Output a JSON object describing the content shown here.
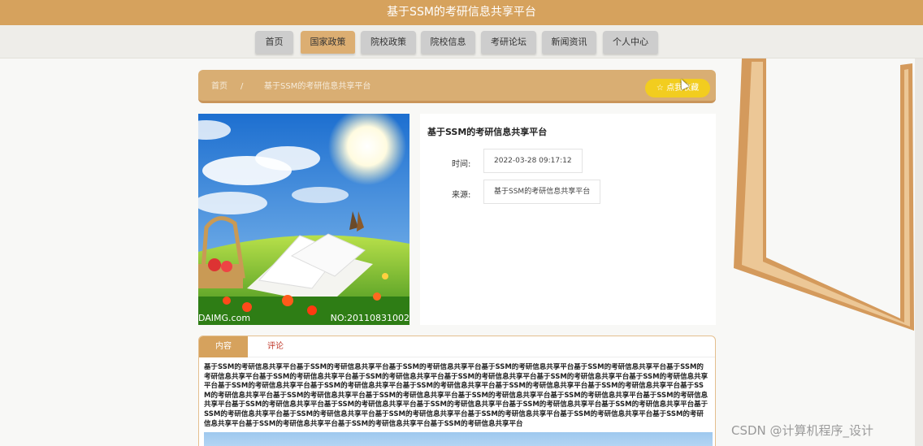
{
  "app": {
    "title": "基于SSM的考研信息共享平台"
  },
  "nav": {
    "items": [
      {
        "label": "首页",
        "active": false
      },
      {
        "label": "国家政策",
        "active": true
      },
      {
        "label": "院校政策",
        "active": false
      },
      {
        "label": "院校信息",
        "active": false
      },
      {
        "label": "考研论坛",
        "active": false
      },
      {
        "label": "新闻资讯",
        "active": false
      },
      {
        "label": "个人中心",
        "active": false
      }
    ]
  },
  "breadcrumb": {
    "home": "首页",
    "separator": "/",
    "current": "基于SSM的考研信息共享平台"
  },
  "favorite": {
    "label": "☆ 点我收藏"
  },
  "image": {
    "left_caption": "DAIMG.com",
    "right_caption": "NO:20110831002"
  },
  "detail": {
    "title": "基于SSM的考研信息共享平台",
    "time_label": "时间:",
    "time_value": "2022-03-28 09:17:12",
    "source_label": "来源:",
    "source_value": "基于SSM的考研信息共享平台"
  },
  "tabs": [
    {
      "label": "内容"
    },
    {
      "label": "评论"
    }
  ],
  "content": {
    "body": "基于SSM的考研信息共享平台基于SSM的考研信息共享平台基于SSM的考研信息共享平台基于SSM的考研信息共享平台基于SSM的考研信息共享平台基于SSM的考研信息共享平台基于SSM的考研信息共享平台基于SSM的考研信息共享平台基于SSM的考研信息共享平台基于SSM的考研信息共享平台基于SSM的考研信息共享平台基于SSM的考研信息共享平台基于SSM的考研信息共享平台基于SSM的考研信息共享平台基于SSM的考研信息共享平台基于SSM的考研信息共享平台基于SSM的考研信息共享平台基于SSM的考研信息共享平台基于SSM的考研信息共享平台基于SSM的考研信息共享平台基于SSM的考研信息共享平台基于SSM的考研信息共享平台基于SSM的考研信息共享平台基于SSM的考研信息共享平台基于SSM的考研信息共享平台基于SSM的考研信息共享平台基于SSM的考研信息共享平台基于SSM的考研信息共享平台基于SSM的考研信息共享平台基于SSM的考研信息共享平台基于SSM的考研信息共享平台基于SSM的考研信息共享平台基于SSM的考研信息共享平台基于SSM的考研信息共享平台基于SSM的考研信息共享平台基于SSM的考研信息共享平台"
  },
  "watermark": "CSDN @计算机程序_设计",
  "colors": {
    "primary": "#d6a25d",
    "favorite": "#f2cd1f",
    "nav_inactive": "#cdcdcd"
  }
}
